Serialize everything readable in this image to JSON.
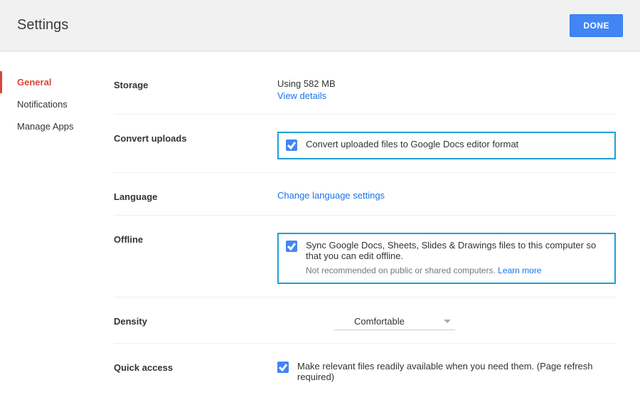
{
  "header": {
    "title": "Settings",
    "done_label": "DONE"
  },
  "sidebar": {
    "items": [
      {
        "label": "General",
        "active": true
      },
      {
        "label": "Notifications"
      },
      {
        "label": "Manage Apps"
      }
    ]
  },
  "storage": {
    "label": "Storage",
    "usage_text": "Using 582 MB",
    "view_details": "View details"
  },
  "convert": {
    "label": "Convert uploads",
    "checkbox_checked": true,
    "text": "Convert uploaded files to Google Docs editor format"
  },
  "language": {
    "label": "Language",
    "link_text": "Change language settings"
  },
  "offline": {
    "label": "Offline",
    "checkbox_checked": true,
    "text": "Sync Google Docs, Sheets, Slides & Drawings files to this computer so that you can edit offline.",
    "note_prefix": "Not recommended on public or shared computers. ",
    "learn_more": "Learn more"
  },
  "density": {
    "label": "Density",
    "selected": "Comfortable"
  },
  "quick_access": {
    "label": "Quick access",
    "checkbox_checked": true,
    "text": "Make relevant files readily available when you need them. (Page refresh required)"
  }
}
